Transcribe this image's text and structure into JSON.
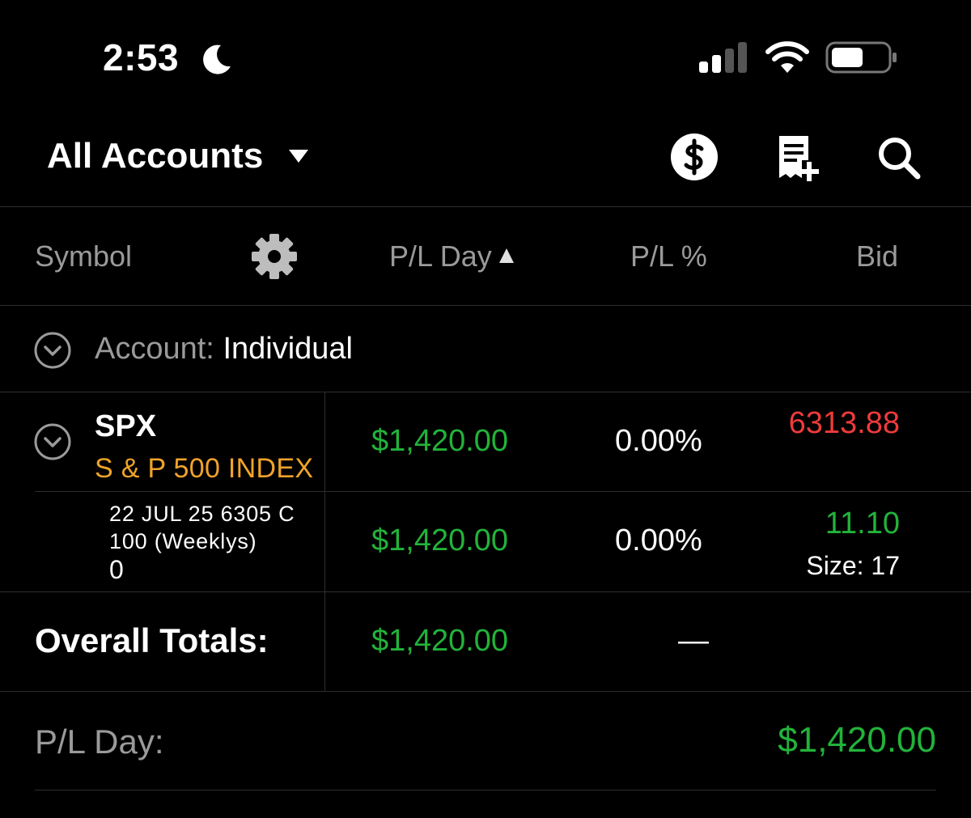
{
  "status_bar": {
    "time": "2:53"
  },
  "header": {
    "account_selector": "All Accounts"
  },
  "columns": {
    "symbol": "Symbol",
    "pl_day": "P/L Day",
    "pl_pct": "P/L %",
    "bid": "Bid"
  },
  "account_group": {
    "label": "Account:",
    "value": "Individual"
  },
  "position": {
    "symbol": "SPX",
    "description": "S & P 500 INDEX",
    "pl_day": "$1,420.00",
    "pl_pct": "0.00%",
    "bid": "6313.88",
    "option": {
      "line1": "22 JUL 25 6305 C",
      "line2": "100 (Weeklys)",
      "line3": "0",
      "pl_day": "$1,420.00",
      "pl_pct": "0.00%",
      "bid": "11.10",
      "size": "Size: 17"
    }
  },
  "totals": {
    "label": "Overall Totals:",
    "pl_day": "$1,420.00",
    "pl_pct": "—"
  },
  "summary": {
    "label": "P/L Day:",
    "value": "$1,420.00"
  },
  "colors": {
    "gain": "#22b33a",
    "loss": "#ee3b3b",
    "description": "#f0a32a",
    "muted": "#9a9a9a"
  }
}
